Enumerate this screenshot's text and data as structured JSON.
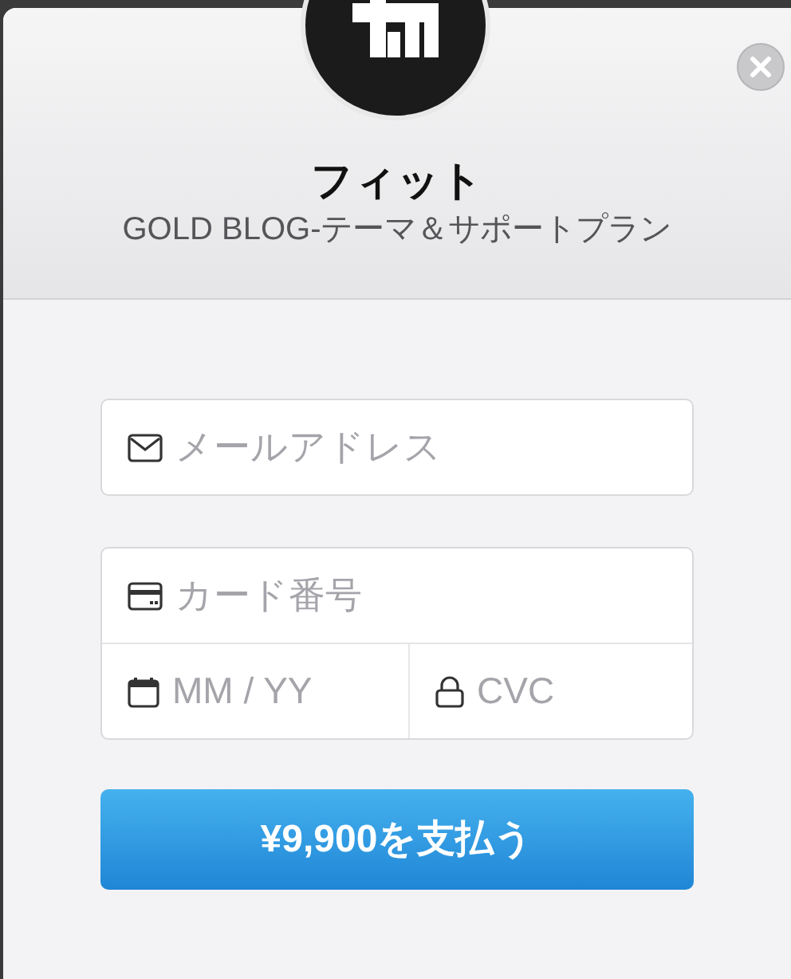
{
  "header": {
    "title": "フィット",
    "subtitle": "GOLD BLOG-テーマ＆サポートプラン"
  },
  "email": {
    "placeholder": "メールアドレス"
  },
  "card": {
    "number_placeholder": "カード番号",
    "expiry_placeholder": "MM / YY",
    "cvc_placeholder": "CVC"
  },
  "pay_button": "¥9,900を支払う"
}
